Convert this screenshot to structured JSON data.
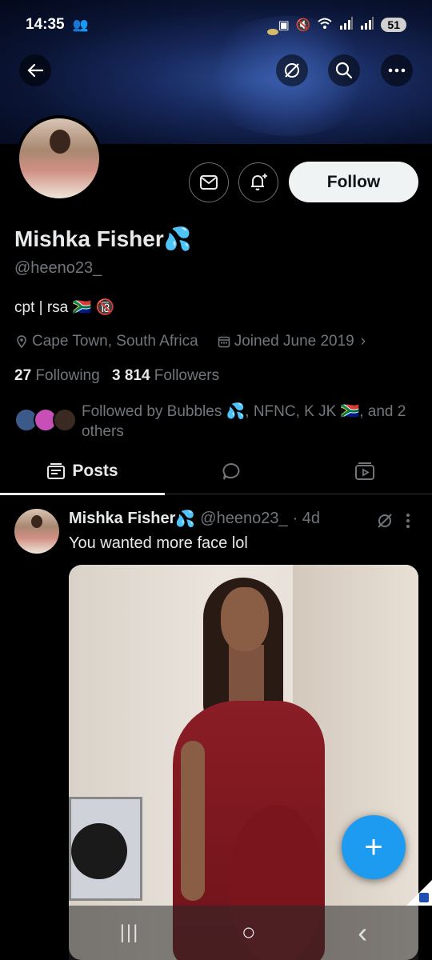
{
  "status_bar": {
    "time": "14:35",
    "people_icon": "people-icon",
    "battery": "51",
    "icons": [
      "notification-icon",
      "mute-icon",
      "wifi-icon",
      "signal-icon",
      "signal-icon"
    ]
  },
  "top_nav": {
    "back_icon": "arrow-left-icon",
    "grok_icon": "slash-circle-icon",
    "search_icon": "search-icon",
    "more_icon": "more-icon"
  },
  "profile": {
    "name": "Mishka Fisher",
    "name_emoji": "💦",
    "handle": "@heeno23_",
    "bio": "cpt | rsa 🇿🇦 🔞",
    "location": "Cape Town, South Africa",
    "joined": "Joined June 2019",
    "following_count": "27",
    "following_label": "Following",
    "followers_count": "3 814",
    "followers_label": "Followers",
    "followed_by": "Followed by Bubbles 💦, NFNC, K JK 🇿🇦, and 2 others",
    "follow_button": "Follow"
  },
  "tabs": {
    "posts_label": "Posts"
  },
  "post": {
    "name": "Mishka Fisher",
    "name_emoji": "💦",
    "handle": "@heeno23_",
    "time": "· 4d",
    "text": "You wanted more face lol"
  },
  "fab_label": "+",
  "navbar": {
    "recent": "|||",
    "home": "○",
    "back": "‹"
  },
  "colors": {
    "accent": "#1d9bf0",
    "secondary_text": "#71767b",
    "primary_text": "#e7e9ea"
  }
}
